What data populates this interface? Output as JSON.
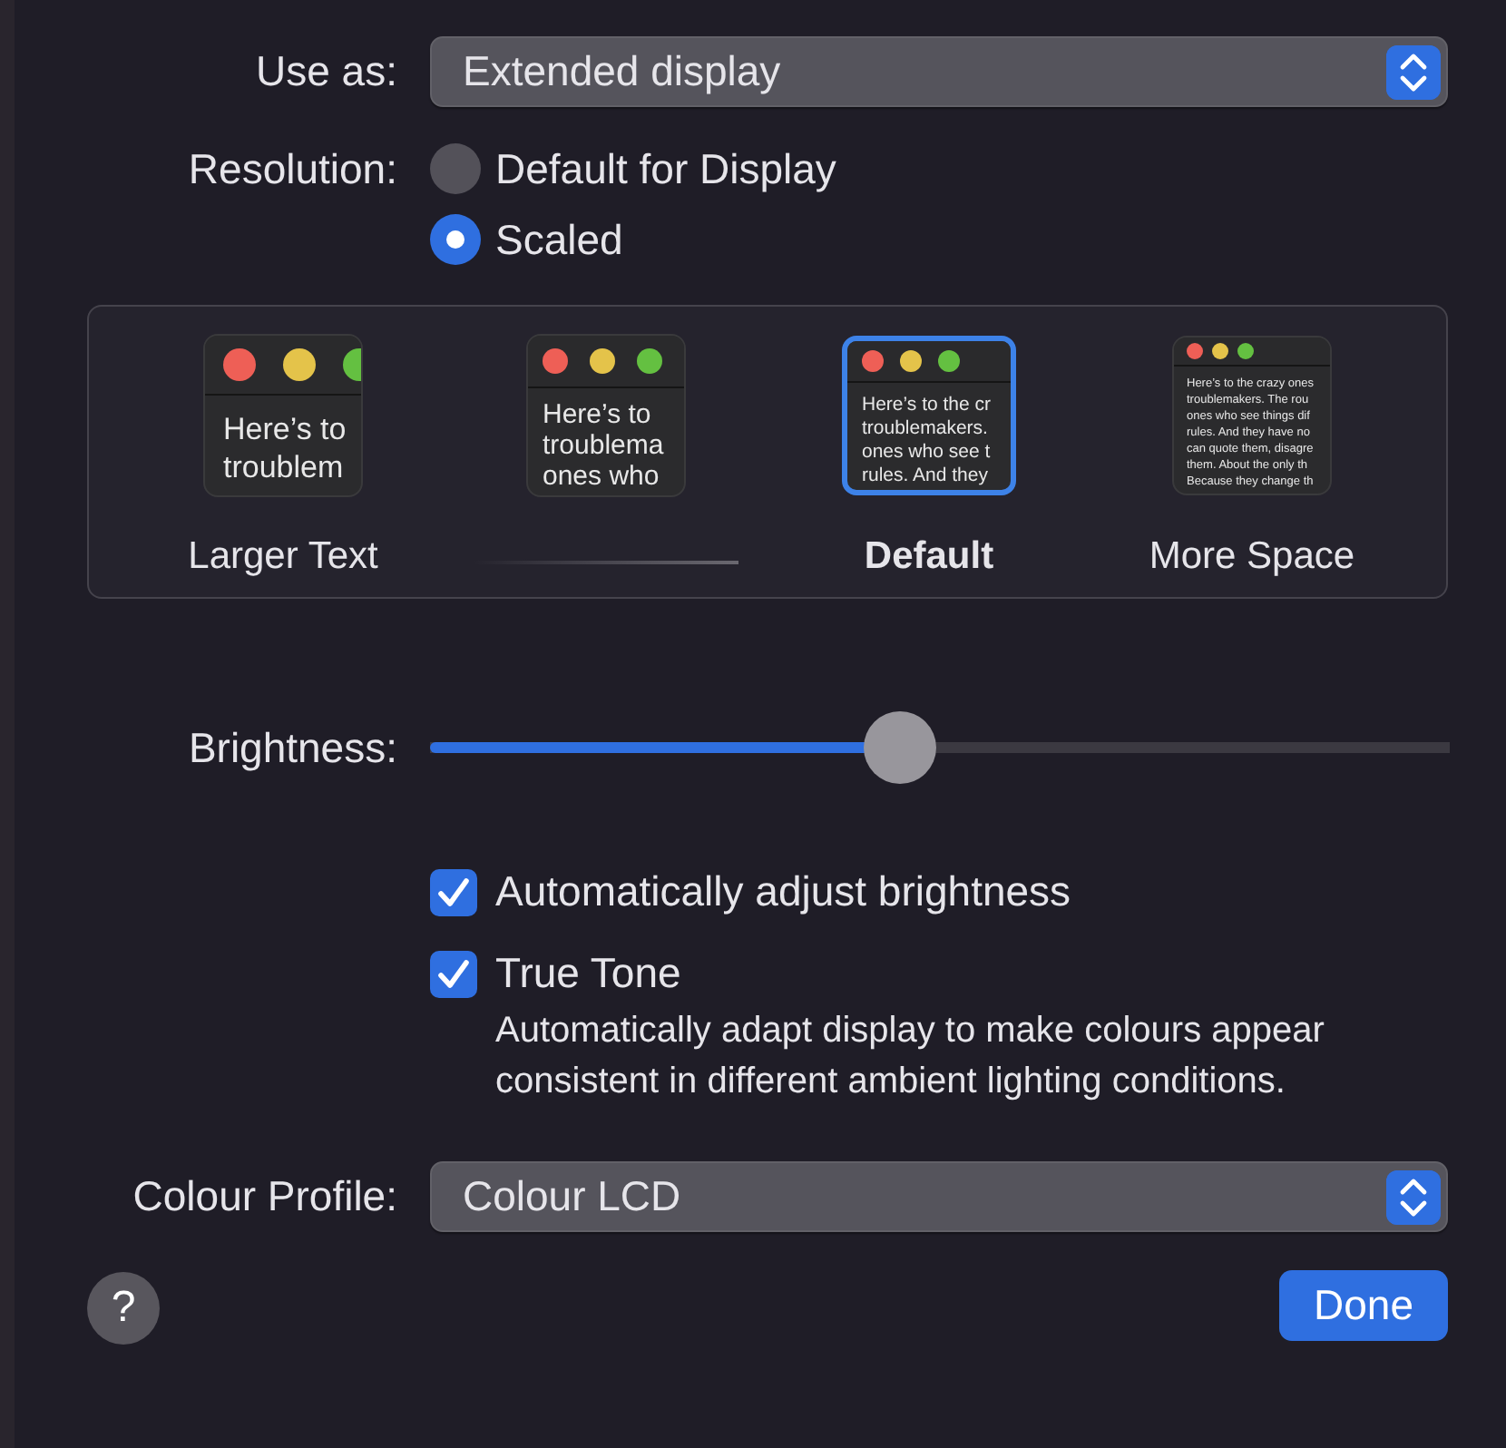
{
  "use_as": {
    "label": "Use as:",
    "value": "Extended display"
  },
  "resolution": {
    "label": "Resolution:",
    "options": [
      {
        "label": "Default for Display",
        "selected": false
      },
      {
        "label": "Scaled",
        "selected": true
      }
    ]
  },
  "scaled_options": [
    {
      "label": "Larger Text",
      "selected": false,
      "preview_lines": [
        "Here’s to",
        "troublem"
      ]
    },
    {
      "selected": false,
      "preview_lines": [
        "Here’s to",
        "troublema",
        "ones who"
      ]
    },
    {
      "label": "Default",
      "selected": true,
      "preview_lines": [
        "Here’s to the cr",
        "troublemakers.",
        "ones who see t",
        "rules. And they"
      ]
    },
    {
      "label": "More Space",
      "selected": false,
      "preview_lines": [
        "Here’s to the crazy ones",
        "troublemakers. The rou",
        "ones who see things dif",
        "rules. And they have no",
        "can quote them, disagre",
        "them. About the only th",
        "Because they change th"
      ]
    }
  ],
  "brightness": {
    "label": "Brightness:",
    "level": 0.46
  },
  "checkboxes": [
    {
      "label": "Automatically adjust brightness",
      "checked": true
    },
    {
      "label": "True Tone",
      "checked": true,
      "description": "Automatically adapt display to make colours appear consistent in different ambient lighting conditions."
    }
  ],
  "colour_profile": {
    "label": "Colour Profile:",
    "value": "Colour LCD"
  },
  "help_button": "?",
  "done_button": "Done"
}
